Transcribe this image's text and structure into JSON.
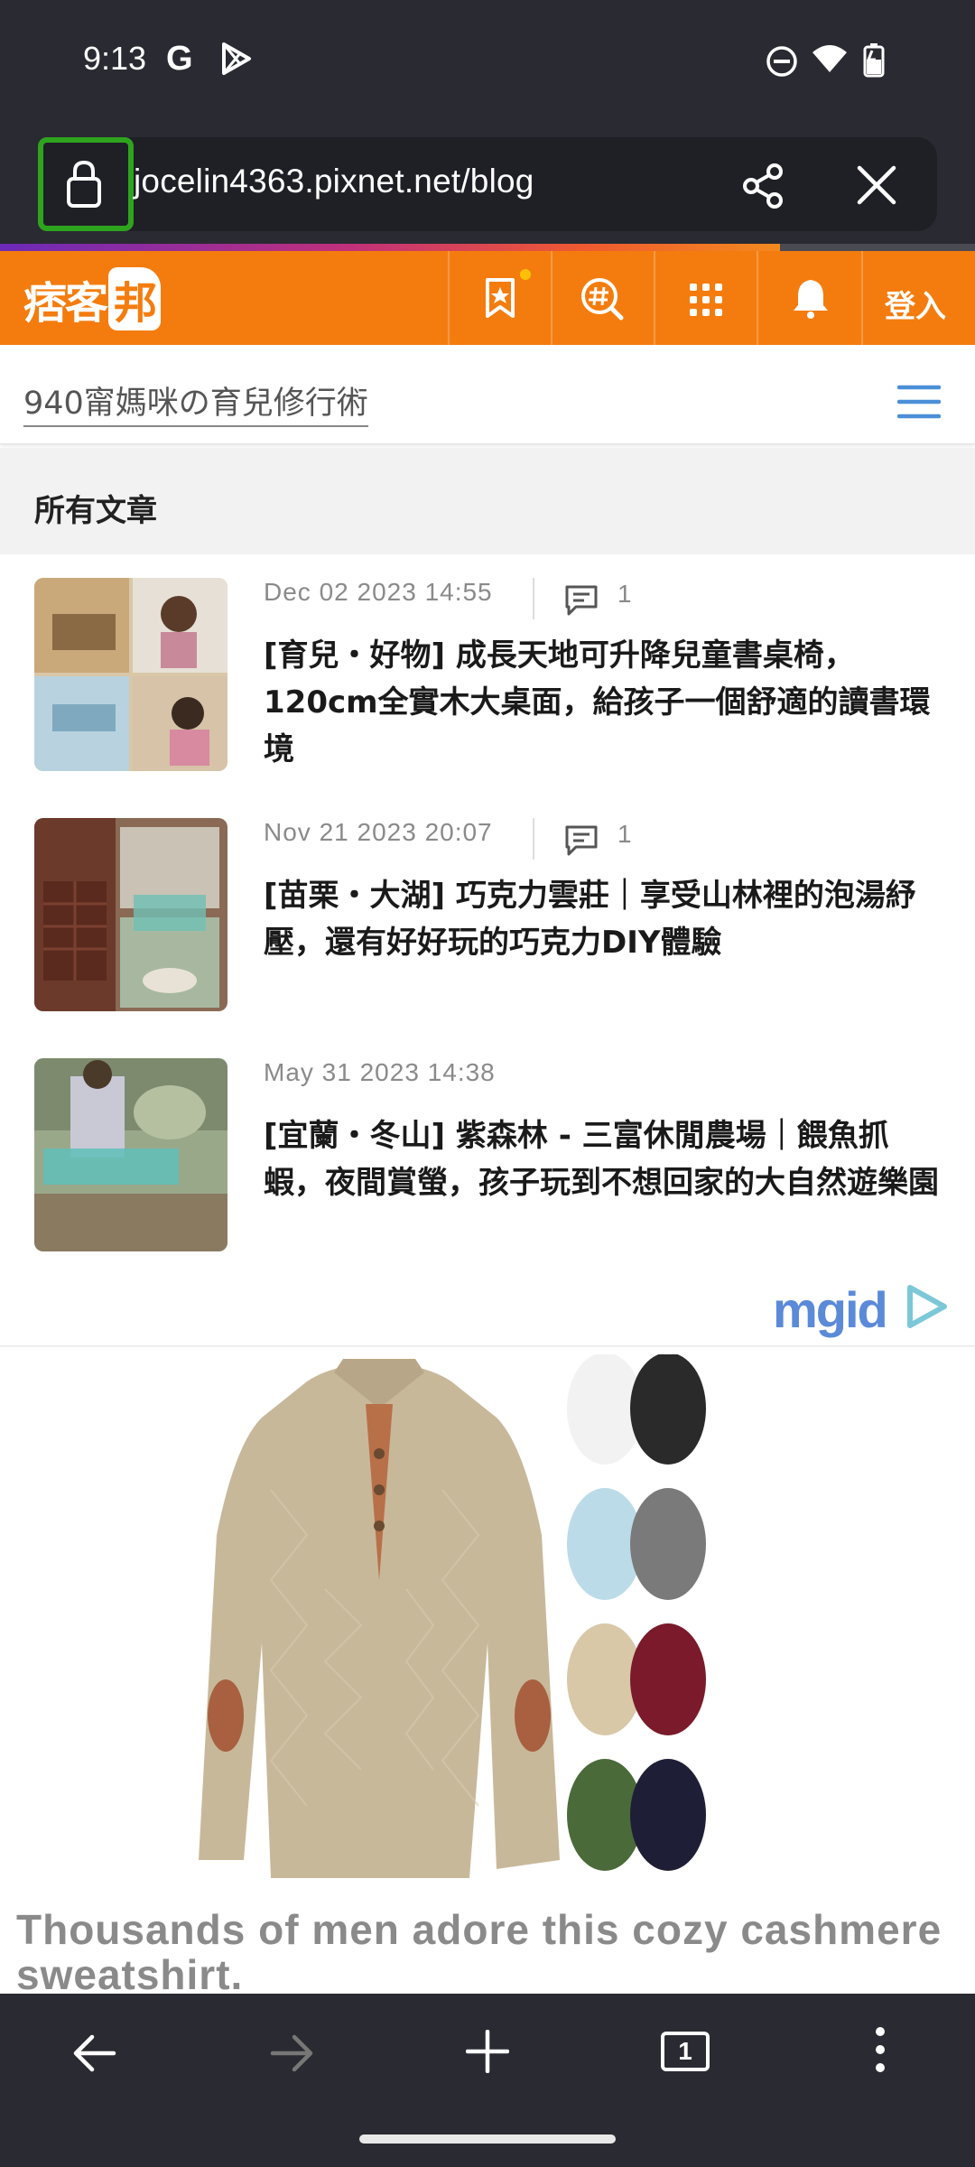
{
  "status_bar": {
    "time": "9:13",
    "google_letter": "G"
  },
  "url_bar": {
    "url": "jocelin4363.pixnet.net/blog"
  },
  "site_header": {
    "logo_text": "痞客",
    "logo_bang": "邦",
    "login_label": "登入",
    "accent_color": "#f47c0e"
  },
  "blog": {
    "title": "940甯媽咪の育兒修行術"
  },
  "section": {
    "title": "所有文章"
  },
  "articles": [
    {
      "date": "Dec 02 2023 14:55",
      "comments": "1",
      "title": "[育兒・好物] 成長天地可升降兒童書桌椅，120cm全實木大桌面，給孩子一個舒適的讀書環境"
    },
    {
      "date": "Nov 21 2023 20:07",
      "comments": "1",
      "title": "[苗栗・大湖] 巧克力雲莊｜享受山林裡的泡湯紓壓，還有好好玩的巧克力DIY體驗"
    },
    {
      "date": "May 31 2023 14:38",
      "comments": "",
      "title": "[宜蘭・冬山] 紫森林 - 三富休閒農場｜餵魚抓蝦，夜間賞螢，孩子玩到不想回家的大自然遊樂園"
    }
  ],
  "ad": {
    "brand": "mgid",
    "headline": "Thousands of men adore this cozy cashmere sweatshirt."
  },
  "bottom_bar": {
    "tab_count": "1"
  }
}
